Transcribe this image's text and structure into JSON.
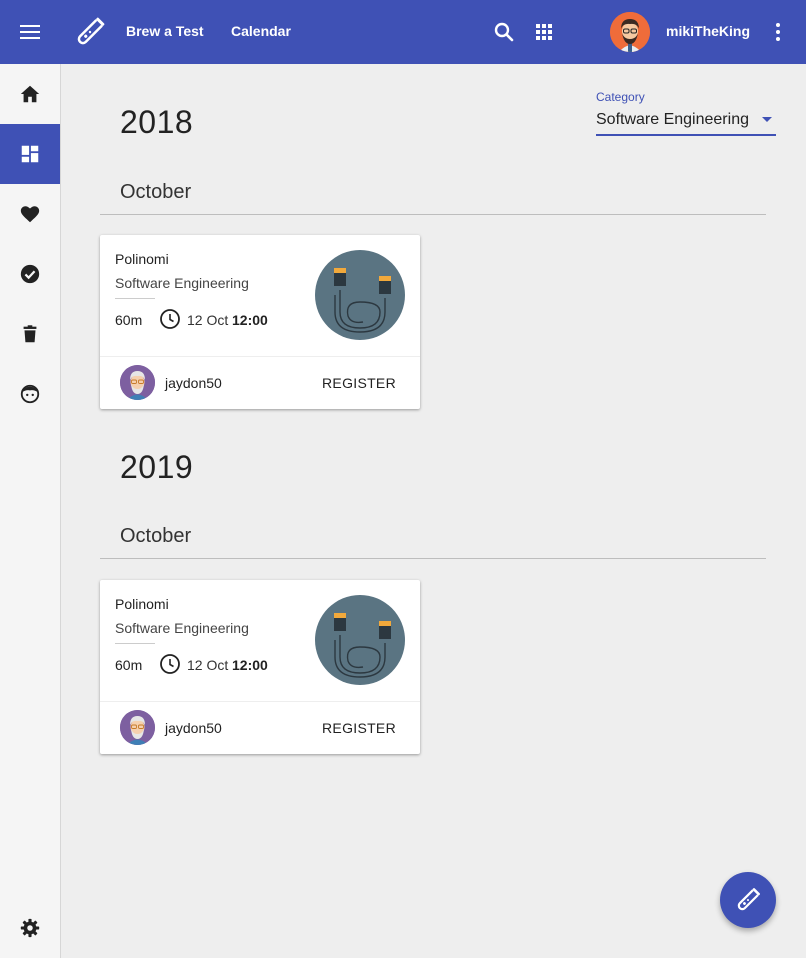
{
  "topbar": {
    "nav": [
      {
        "label": "Brew a Test"
      },
      {
        "label": "Calendar"
      }
    ],
    "username": "mikiTheKing",
    "icons": {
      "menu": "menu-icon",
      "logo": "test-tube-icon",
      "search": "search-icon",
      "apps": "apps-grid-icon",
      "more": "more-vert-icon"
    }
  },
  "sidebar": {
    "items": [
      {
        "icon": "home-icon"
      },
      {
        "icon": "dashboard-icon",
        "active": true
      },
      {
        "icon": "heart-icon"
      },
      {
        "icon": "check-circle-icon"
      },
      {
        "icon": "trash-icon"
      },
      {
        "icon": "face-icon"
      },
      {
        "icon": "settings-icon"
      }
    ]
  },
  "category": {
    "label": "Category",
    "value": "Software Engineering"
  },
  "groups": [
    {
      "year": "2018",
      "month": "October",
      "cards": [
        {
          "title": "Polinomi",
          "category": "Software Engineering",
          "duration": "60m",
          "date": "12 Oct",
          "time": "12:00",
          "author": "jaydon50",
          "action": "REGISTER"
        }
      ]
    },
    {
      "year": "2019",
      "month": "October",
      "cards": [
        {
          "title": "Polinomi",
          "category": "Software Engineering",
          "duration": "60m",
          "date": "12 Oct",
          "time": "12:00",
          "author": "jaydon50",
          "action": "REGISTER"
        }
      ]
    }
  ],
  "colors": {
    "primary": "#3f51b5",
    "background": "#eeeeee",
    "card_image": "#5a7482"
  }
}
